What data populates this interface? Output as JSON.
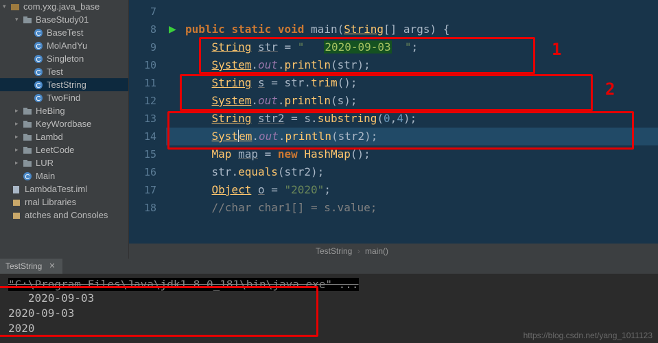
{
  "sidebar": {
    "root": "com.yxg.java_base",
    "items": [
      {
        "label": "BaseStudy01",
        "type": "folder",
        "depth": 1,
        "expanded": true
      },
      {
        "label": "BaseTest",
        "type": "class",
        "depth": 2
      },
      {
        "label": "MolAndYu",
        "type": "class",
        "depth": 2
      },
      {
        "label": "Singleton",
        "type": "class",
        "depth": 2
      },
      {
        "label": "Test",
        "type": "class",
        "depth": 2
      },
      {
        "label": "TestString",
        "type": "class",
        "depth": 2,
        "selected": true
      },
      {
        "label": "TwoFind",
        "type": "class",
        "depth": 2
      },
      {
        "label": "HeBing",
        "type": "folder",
        "depth": 1
      },
      {
        "label": "KeyWordbase",
        "type": "folder",
        "depth": 1
      },
      {
        "label": "Lambd",
        "type": "folder",
        "depth": 1
      },
      {
        "label": "LeetCode",
        "type": "folder",
        "depth": 1
      },
      {
        "label": "LUR",
        "type": "folder",
        "depth": 1
      },
      {
        "label": "Main",
        "type": "class",
        "depth": 1
      },
      {
        "label": "LambdaTest.iml",
        "type": "file",
        "depth": 0
      },
      {
        "label": "rnal Libraries",
        "type": "lib",
        "depth": 0
      },
      {
        "label": "atches and Consoles",
        "type": "scratch",
        "depth": 0
      }
    ]
  },
  "editor": {
    "first_line_no": 7,
    "lines": [
      {
        "n": 7,
        "tokens": []
      },
      {
        "n": 8,
        "tokens": [
          [
            "kw",
            "public "
          ],
          [
            "kw",
            "static "
          ],
          [
            "kw",
            "void "
          ],
          [
            "ident",
            "main"
          ],
          [
            "punc",
            "("
          ],
          [
            "typ",
            "String"
          ],
          [
            "punc",
            "[] "
          ],
          [
            "ident",
            "args"
          ],
          [
            "punc",
            ") {"
          ]
        ]
      },
      {
        "n": 9,
        "tokens": [
          [
            "indent",
            "    "
          ],
          [
            "typ",
            "String"
          ],
          [
            "ident",
            " "
          ],
          [
            "var",
            "str"
          ],
          [
            "ident",
            " = "
          ],
          [
            "str",
            "\"   "
          ],
          [
            "hl",
            "2020-09-03"
          ],
          [
            "str",
            "  \""
          ],
          [
            "punc",
            ";"
          ]
        ]
      },
      {
        "n": 10,
        "tokens": [
          [
            "indent",
            "    "
          ],
          [
            "typ",
            "System"
          ],
          [
            "punc",
            "."
          ],
          [
            "field",
            "out"
          ],
          [
            "punc",
            "."
          ],
          [
            "func",
            "println"
          ],
          [
            "punc",
            "("
          ],
          [
            "ident",
            "str"
          ],
          [
            "punc",
            ");"
          ]
        ]
      },
      {
        "n": 11,
        "tokens": [
          [
            "indent",
            "    "
          ],
          [
            "typ",
            "String"
          ],
          [
            "ident",
            " "
          ],
          [
            "var",
            "s"
          ],
          [
            "ident",
            " = "
          ],
          [
            "ident",
            "str"
          ],
          [
            "punc",
            "."
          ],
          [
            "func",
            "trim"
          ],
          [
            "punc",
            "();"
          ]
        ]
      },
      {
        "n": 12,
        "tokens": [
          [
            "indent",
            "    "
          ],
          [
            "typ",
            "System"
          ],
          [
            "punc",
            "."
          ],
          [
            "field",
            "out"
          ],
          [
            "punc",
            "."
          ],
          [
            "func",
            "println"
          ],
          [
            "punc",
            "("
          ],
          [
            "ident",
            "s"
          ],
          [
            "punc",
            ");"
          ]
        ]
      },
      {
        "n": 13,
        "tokens": [
          [
            "indent",
            "    "
          ],
          [
            "typ",
            "String"
          ],
          [
            "ident",
            " "
          ],
          [
            "var",
            "str2"
          ],
          [
            "ident",
            " = "
          ],
          [
            "ident",
            "s"
          ],
          [
            "punc",
            "."
          ],
          [
            "func",
            "substring"
          ],
          [
            "punc",
            "("
          ],
          [
            "num",
            "0"
          ],
          [
            "punc",
            ","
          ],
          [
            "num",
            "4"
          ],
          [
            "punc",
            ");"
          ]
        ]
      },
      {
        "n": 14,
        "current": true,
        "tokens": [
          [
            "indent",
            "    "
          ],
          [
            "typ",
            "Syst"
          ],
          [
            "caret",
            ""
          ],
          [
            "typ2",
            "em"
          ],
          [
            "punc",
            "."
          ],
          [
            "field",
            "out"
          ],
          [
            "punc",
            "."
          ],
          [
            "func",
            "println"
          ],
          [
            "punc",
            "("
          ],
          [
            "ident",
            "str2"
          ],
          [
            "punc",
            ");"
          ]
        ]
      },
      {
        "n": 15,
        "tokens": [
          [
            "indent",
            "    "
          ],
          [
            "typw",
            "Map"
          ],
          [
            "ident",
            " "
          ],
          [
            "var",
            "map"
          ],
          [
            "ident",
            " = "
          ],
          [
            "kw",
            "new "
          ],
          [
            "typw",
            "HashMap"
          ],
          [
            "punc",
            "();"
          ]
        ]
      },
      {
        "n": 16,
        "tokens": [
          [
            "indent",
            "    "
          ],
          [
            "ident",
            "str"
          ],
          [
            "punc",
            "."
          ],
          [
            "func",
            "equals"
          ],
          [
            "punc",
            "("
          ],
          [
            "ident",
            "str2"
          ],
          [
            "punc",
            ");"
          ]
        ]
      },
      {
        "n": 17,
        "tokens": [
          [
            "indent",
            "    "
          ],
          [
            "typ",
            "Object"
          ],
          [
            "ident",
            " "
          ],
          [
            "var",
            "o"
          ],
          [
            "ident",
            " = "
          ],
          [
            "str",
            "\"2020\""
          ],
          [
            "punc",
            ";"
          ]
        ]
      },
      {
        "n": 18,
        "tokens": [
          [
            "indent",
            "    "
          ],
          [
            "comment",
            "//char char1[] = s.value;"
          ]
        ]
      }
    ],
    "breadcrumb": [
      "TestString",
      "main()"
    ],
    "annotations": {
      "one": "1",
      "two": "2"
    }
  },
  "console": {
    "tab_label": "TestString",
    "command": "\"C:\\Program Files\\Java\\jdk1.8.0_181\\bin\\java.exe\" ...",
    "output": [
      "   2020-09-03  ",
      "2020-09-03",
      "2020"
    ]
  },
  "footer": {
    "watermark": "https://blog.csdn.net/yang_1011123"
  }
}
